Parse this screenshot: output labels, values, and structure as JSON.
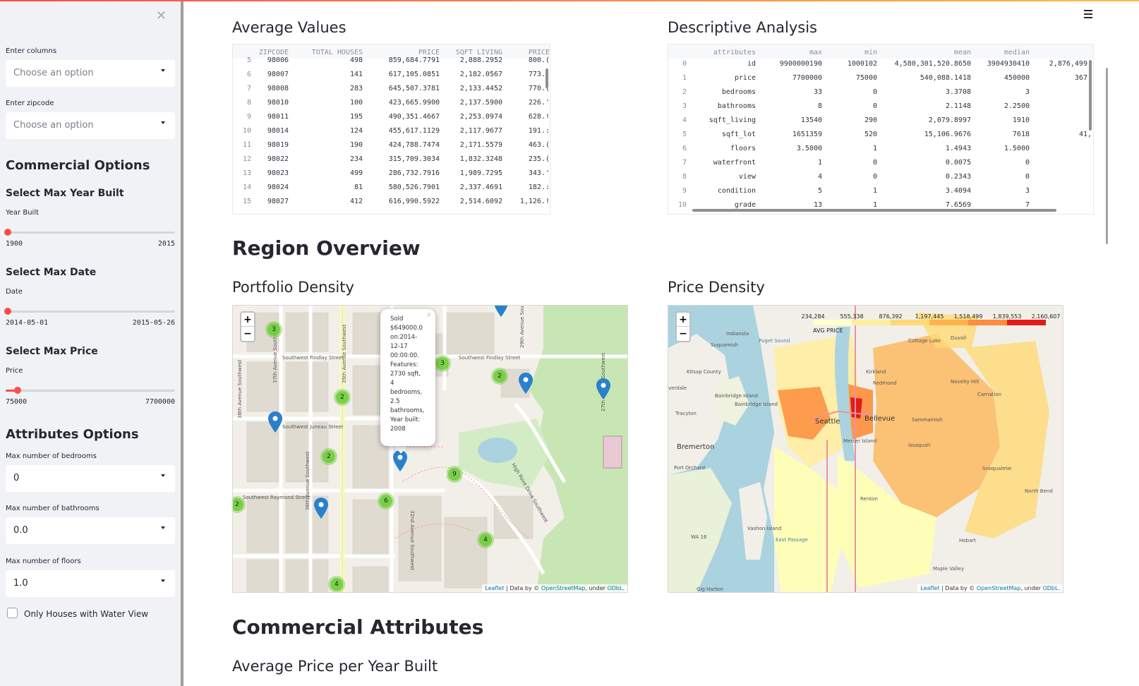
{
  "sidebar": {
    "enter_columns_label": "Enter columns",
    "enter_columns_placeholder": "Choose an option",
    "enter_zipcode_label": "Enter zipcode",
    "enter_zipcode_placeholder": "Choose an option",
    "commercial_options_heading": "Commercial Options",
    "max_year_heading": "Select Max Year Built",
    "year_label": "Year Built",
    "year_min": "1900",
    "year_max": "2015",
    "year_fraction": 0.0,
    "max_date_heading": "Select Max Date",
    "date_label": "Date",
    "date_min": "2014-05-01",
    "date_max": "2015-05-26",
    "date_fraction": 0.0,
    "max_price_heading": "Select Max Price",
    "price_label": "Price",
    "price_min": "75000",
    "price_max": "7700000",
    "price_fraction": 0.06,
    "attributes_options_heading": "Attributes Options",
    "bedrooms_label": "Max number of bedrooms",
    "bedrooms_value": "0",
    "bathrooms_label": "Max number of bathrooms",
    "bathrooms_value": "0.0",
    "floors_label": "Max number of floors",
    "floors_value": "1.0",
    "water_view_label": "Only Houses with Water View",
    "water_view_checked": false,
    "accent_color": "#ff4b4b"
  },
  "main": {
    "avg_values_title": "Average Values",
    "descriptive_title": "Descriptive Analysis",
    "region_overview_title": "Region Overview",
    "portfolio_density_title": "Portfolio Density",
    "price_density_title": "Price Density",
    "commercial_attributes_title": "Commercial Attributes",
    "avg_price_year_title": "Average Price per Year Built"
  },
  "avg_table": {
    "headers": [
      "ZIPCODE",
      "TOTAL HOUSES",
      "PRICE",
      "SQFT LIVING",
      "PRICE"
    ],
    "rows": [
      [
        "5",
        "98006",
        "498",
        "859,684.7791",
        "2,888.2952",
        "800.("
      ],
      [
        "6",
        "98007",
        "141",
        "617,105.0851",
        "2,182.0567",
        "773.'"
      ],
      [
        "7",
        "98008",
        "283",
        "645,507.3781",
        "2,133.4452",
        "770.("
      ],
      [
        "8",
        "98010",
        "100",
        "423,665.9900",
        "2,137.5900",
        "226.'"
      ],
      [
        "9",
        "98011",
        "195",
        "490,351.4667",
        "2,253.0974",
        "628.!"
      ],
      [
        "10",
        "98014",
        "124",
        "455,617.1129",
        "2,117.9677",
        "191.:"
      ],
      [
        "11",
        "98019",
        "190",
        "424,788.7474",
        "2,171.5579",
        "463.("
      ],
      [
        "12",
        "98022",
        "234",
        "315,709.3034",
        "1,832.3248",
        "235.("
      ],
      [
        "13",
        "98023",
        "499",
        "286,732.7916",
        "1,989.7295",
        "343.'"
      ],
      [
        "14",
        "98024",
        "81",
        "580,526.7901",
        "2,337.4691",
        "182.:"
      ],
      [
        "15",
        "98027",
        "412",
        "616,990.5922",
        "2,514.6092",
        "1,126.!"
      ]
    ]
  },
  "desc_table": {
    "headers": [
      "attributes",
      "max",
      "min",
      "mean",
      "median"
    ],
    "rows": [
      [
        "0",
        "id",
        "9900000190",
        "1000102",
        "4,580,301,520.8650",
        "3904930410",
        "2,876,499,"
      ],
      [
        "1",
        "price",
        "7700000",
        "75000",
        "540,088.1418",
        "450000",
        "367,"
      ],
      [
        "2",
        "bedrooms",
        "33",
        "0",
        "3.3708",
        "3",
        ""
      ],
      [
        "3",
        "bathrooms",
        "8",
        "0",
        "2.1148",
        "2.2500",
        ""
      ],
      [
        "4",
        "sqft_living",
        "13540",
        "290",
        "2,079.8997",
        "1910",
        ""
      ],
      [
        "5",
        "sqft_lot",
        "1651359",
        "520",
        "15,106.9676",
        "7618",
        "41,"
      ],
      [
        "6",
        "floors",
        "3.5000",
        "1",
        "1.4943",
        "1.5000",
        ""
      ],
      [
        "7",
        "waterfront",
        "1",
        "0",
        "0.0075",
        "0",
        ""
      ],
      [
        "8",
        "view",
        "4",
        "0",
        "0.2343",
        "0",
        ""
      ],
      [
        "9",
        "condition",
        "5",
        "1",
        "3.4094",
        "3",
        ""
      ],
      [
        "10",
        "grade",
        "13",
        "1",
        "7.6569",
        "7",
        ""
      ]
    ]
  },
  "portfolio_map": {
    "zoom_in": "+",
    "zoom_out": "−",
    "attribution_leaflet": "Leaflet",
    "attribution_mid": " | Data by © ",
    "attribution_osm": "OpenStreetMap",
    "attribution_under": ", under ",
    "attribution_odbl": "ODbL.",
    "popup_close": "×",
    "popup_lines": [
      "Sold",
      "$649000.0",
      "on:2014-",
      "12-17",
      "00:00:00.",
      "Features:",
      "2730 sqft,",
      "4",
      "bedrooms,",
      "2.5",
      "bathrooms,",
      "Year built:",
      "2008"
    ],
    "clusters": [
      "3",
      "3",
      "2",
      "2",
      "2",
      "9",
      "6",
      "4",
      "2",
      "4"
    ],
    "street_labels": [
      "Southwest Findlay Street",
      "Southwest Findlay Street",
      "Southwest Raymond Street",
      "35th Avenue Southwest",
      "37th Avenue Southwest",
      "38th Avenue Southwest",
      "36th Avenue Southwest",
      "32nd Avenue Southwest",
      "High Point Drive Southwest",
      "29th Avenue Southwest",
      "27th Avenue Southwest",
      "Southwest Juneau Street"
    ],
    "pin_color": "#2a81cb"
  },
  "price_map": {
    "zoom_in": "+",
    "zoom_out": "−",
    "legend_title": "AVG PRICE",
    "legend_ticks": [
      "234,284",
      "555,338",
      "876,392",
      "1,197,445",
      "1,518,499",
      "1,839,553",
      "2,160,607"
    ],
    "legend_colors": [
      "#ffffcc",
      "#ffeda0",
      "#fed976",
      "#feb24c",
      "#fd8d3c",
      "#e31a1c"
    ],
    "place_labels": [
      "Indianola",
      "Suquamish",
      "Puget Sound",
      "Kitsap County",
      "verdale",
      "Bainbridge Island",
      "Bainbridge Island",
      "Tracyton",
      "Bremerton",
      "Port Orchard",
      "Seattle",
      "Bellevue",
      "Mercer Island",
      "Renton",
      "WA 16",
      "East Passage",
      "Vashon Island",
      "Gig Harbor",
      "Kirkland",
      "Redmond",
      "Issaquah",
      "Sammamish",
      "Snoqualmie",
      "North Bend",
      "Hobart",
      "Maple Valley",
      "Duvall",
      "Cottage Lake",
      "Novelty Hill",
      "Carnation"
    ],
    "attribution_leaflet": "Leaflet",
    "attribution_mid": " | Data by © ",
    "attribution_osm": "OpenStreetMap",
    "attribution_under": ", under ",
    "attribution_odbl": "ODbL."
  }
}
